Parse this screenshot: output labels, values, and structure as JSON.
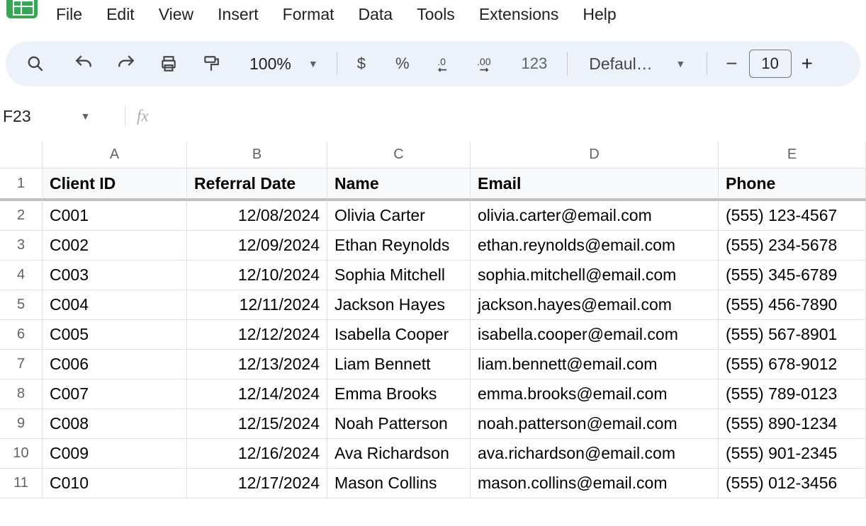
{
  "menubar": {
    "items": [
      "File",
      "Edit",
      "View",
      "Insert",
      "Format",
      "Data",
      "Tools",
      "Extensions",
      "Help"
    ]
  },
  "toolbar": {
    "zoom": "100%",
    "currency_symbol": "$",
    "percent_symbol": "%",
    "number_format": "123",
    "font_name": "Defaul…",
    "font_size": "10"
  },
  "namebox": {
    "cell_ref": "F23",
    "fx": "fx"
  },
  "grid": {
    "columns": [
      "A",
      "B",
      "C",
      "D",
      "E"
    ],
    "header_row": {
      "num": "1",
      "cells": [
        "Client ID",
        "Referral Date",
        "Name",
        "Email",
        "Phone"
      ]
    },
    "rows": [
      {
        "num": "2",
        "cells": [
          "C001",
          "12/08/2024",
          "Olivia Carter",
          "olivia.carter@email.com",
          "(555) 123-4567"
        ]
      },
      {
        "num": "3",
        "cells": [
          "C002",
          "12/09/2024",
          "Ethan Reynolds",
          "ethan.reynolds@email.com",
          "(555) 234-5678"
        ]
      },
      {
        "num": "4",
        "cells": [
          "C003",
          "12/10/2024",
          "Sophia Mitchell",
          "sophia.mitchell@email.com",
          "(555) 345-6789"
        ]
      },
      {
        "num": "5",
        "cells": [
          "C004",
          "12/11/2024",
          "Jackson Hayes",
          "jackson.hayes@email.com",
          "(555) 456-7890"
        ]
      },
      {
        "num": "6",
        "cells": [
          "C005",
          "12/12/2024",
          "Isabella Cooper",
          "isabella.cooper@email.com",
          "(555) 567-8901"
        ]
      },
      {
        "num": "7",
        "cells": [
          "C006",
          "12/13/2024",
          "Liam Bennett",
          "liam.bennett@email.com",
          "(555) 678-9012"
        ]
      },
      {
        "num": "8",
        "cells": [
          "C007",
          "12/14/2024",
          "Emma Brooks",
          "emma.brooks@email.com",
          "(555) 789-0123"
        ]
      },
      {
        "num": "9",
        "cells": [
          "C008",
          "12/15/2024",
          "Noah Patterson",
          "noah.patterson@email.com",
          "(555) 890-1234"
        ]
      },
      {
        "num": "10",
        "cells": [
          "C009",
          "12/16/2024",
          "Ava Richardson",
          "ava.richardson@email.com",
          "(555) 901-2345"
        ]
      },
      {
        "num": "11",
        "cells": [
          "C010",
          "12/17/2024",
          "Mason Collins",
          "mason.collins@email.com",
          "(555) 012-3456"
        ]
      }
    ]
  }
}
